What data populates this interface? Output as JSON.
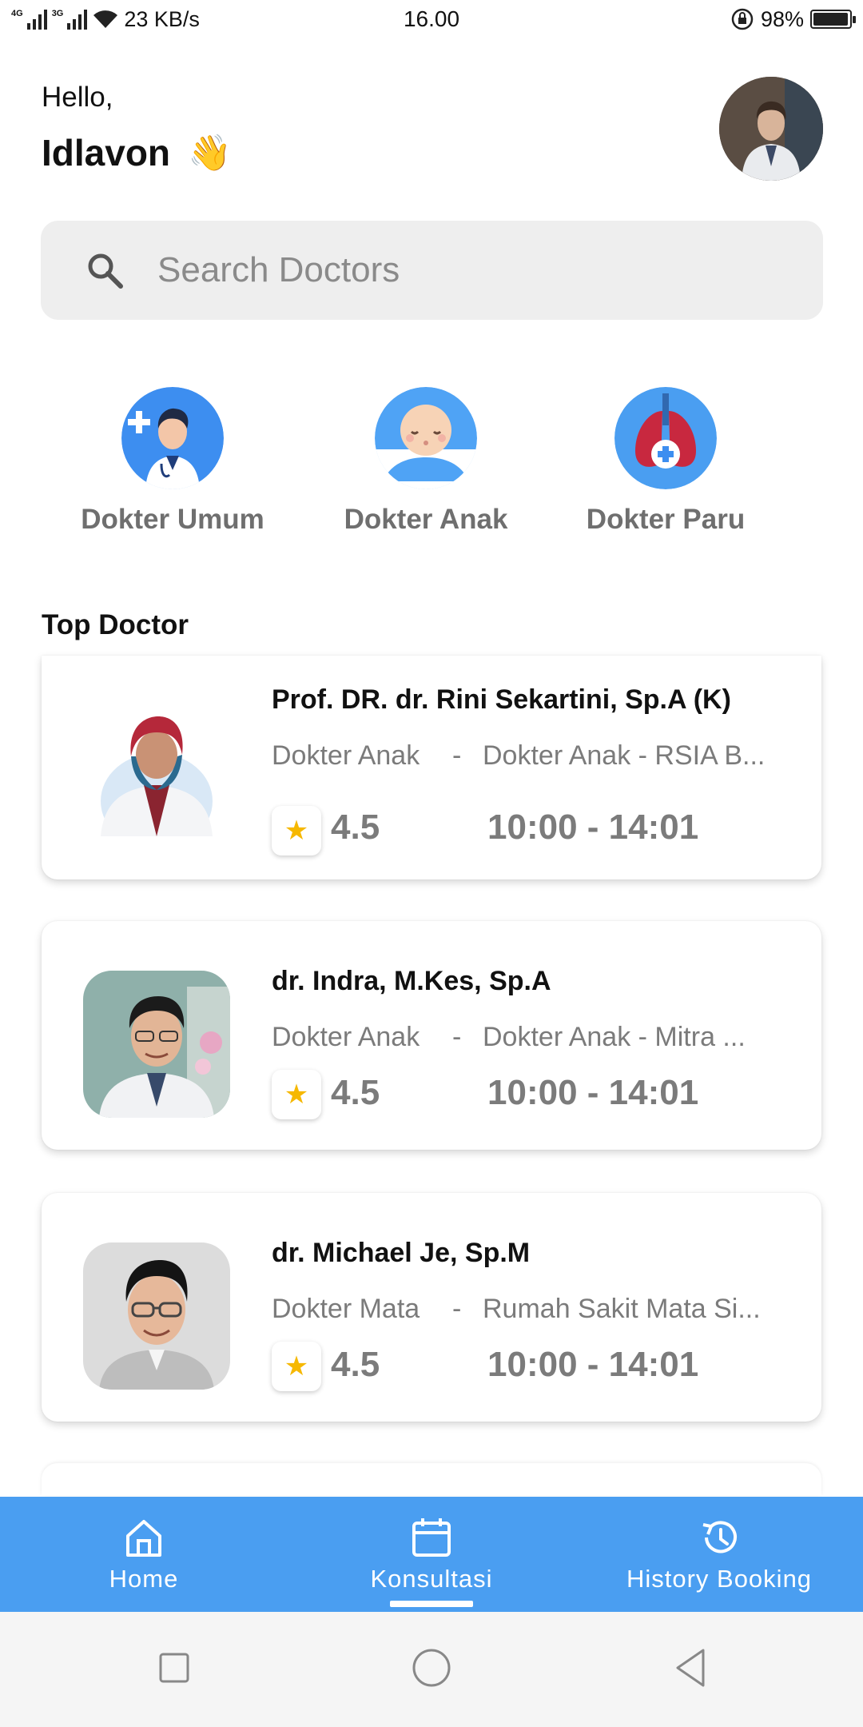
{
  "status_bar": {
    "network_1": "4G",
    "network_2": "3G",
    "speed": "23 KB/s",
    "time": "16.00",
    "battery": "98%",
    "battery_level": 0.98
  },
  "greeting": {
    "hello": "Hello,",
    "name": "Idlavon",
    "emoji": "👋"
  },
  "search": {
    "placeholder": "Search Doctors"
  },
  "categories": [
    {
      "label": "Dokter Umum",
      "icon": "general-doctor-icon"
    },
    {
      "label": "Dokter Anak",
      "icon": "baby-icon"
    },
    {
      "label": "Dokter Paru",
      "icon": "lungs-icon"
    }
  ],
  "top_doctor": {
    "title": "Top Doctor",
    "doctors": [
      {
        "name": "Prof. DR. dr. Rini Sekartini, Sp.A (K)",
        "specialty": "Dokter Anak",
        "separator": "-",
        "hospital": "Dokter Anak - RSIA B...",
        "rating": "4.5",
        "hours": "10:00 - 14:01"
      },
      {
        "name": "dr. Indra, M.Kes, Sp.A",
        "specialty": "Dokter Anak",
        "separator": "-",
        "hospital": "Dokter Anak - Mitra ...",
        "rating": "4.5",
        "hours": "10:00 - 14:01"
      },
      {
        "name": "dr. Michael Je, Sp.M",
        "specialty": "Dokter Mata",
        "separator": "-",
        "hospital": "Rumah Sakit Mata Si...",
        "rating": "4.5",
        "hours": "10:00 - 14:01"
      }
    ]
  },
  "bottom_nav": {
    "items": [
      {
        "label": "Home",
        "icon": "home-icon",
        "active": false
      },
      {
        "label": "Konsultasi",
        "icon": "calendar-icon",
        "active": true
      },
      {
        "label": "History Booking",
        "icon": "history-icon",
        "active": false
      }
    ]
  },
  "colors": {
    "accent": "#4a9ef1",
    "star": "#f6b800",
    "muted_text": "#7b7b7b",
    "search_bg": "#eeeeee"
  }
}
